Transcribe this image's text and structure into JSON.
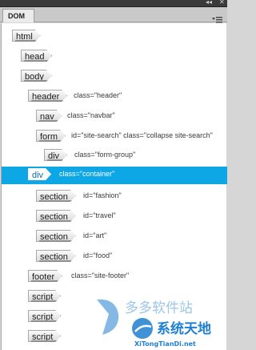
{
  "panel": {
    "tab_label": "DOM"
  },
  "tree": {
    "nodes": [
      {
        "tag": "html",
        "attr": ""
      },
      {
        "tag": "head",
        "attr": ""
      },
      {
        "tag": "body",
        "attr": ""
      },
      {
        "tag": "header",
        "attr": "class=\"header\""
      },
      {
        "tag": "nav",
        "attr": "class=\"navbar\""
      },
      {
        "tag": "form",
        "attr": "id=\"site-search\" class=\"collapse site-search\""
      },
      {
        "tag": "div",
        "attr": "class=\"form-group\""
      },
      {
        "tag": "div",
        "attr": "class=\"container\""
      },
      {
        "tag": "section",
        "attr": "id=\"fashion\""
      },
      {
        "tag": "section",
        "attr": "id=\"travel\""
      },
      {
        "tag": "section",
        "attr": "id=\"art\""
      },
      {
        "tag": "section",
        "attr": "id=\"food\""
      },
      {
        "tag": "footer",
        "attr": "class=\"site-footer\""
      },
      {
        "tag": "script",
        "attr": ""
      },
      {
        "tag": "script",
        "attr": ""
      },
      {
        "tag": "script",
        "attr": ""
      }
    ],
    "selected_node": "div class=\"container\""
  },
  "watermark": {
    "top_text": "多多软件站",
    "bottom_text": "系统天地",
    "url": "XiTongTianDi.net"
  },
  "colors": {
    "selection": "#0ea7e6",
    "tree_background": "#ffffff",
    "panel_chrome": "#c9c9c9"
  },
  "icons": {
    "collapse": "double-chevron-icon",
    "close": "close-icon",
    "panel_menu": "panel-menu-icon"
  }
}
